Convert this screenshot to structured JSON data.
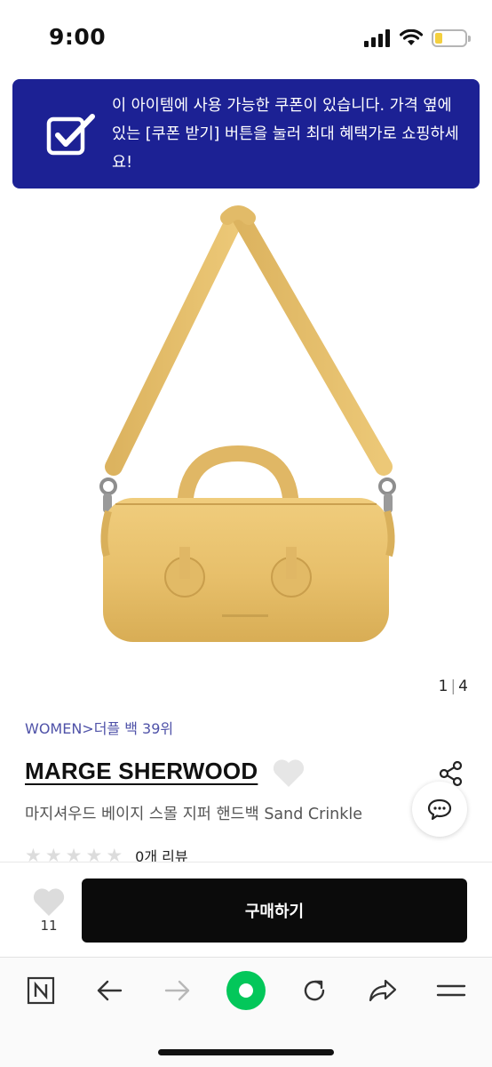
{
  "status_bar": {
    "time": "9:00"
  },
  "coupon_banner": {
    "text": "이 아이템에 사용 가능한 쿠폰이 있습니다. 가격 옆에 있는 [쿠폰 받기] 버튼을 눌러 최대 혜택가로 쇼핑하세요!"
  },
  "product": {
    "pager": {
      "current": "1",
      "separator": "|",
      "total": "4"
    },
    "breadcrumb": {
      "category": "WOMEN",
      "arrow": ">",
      "subcategory": "더플 백",
      "rank": "39위"
    },
    "brand": "MARGE SHERWOOD",
    "name": "마지셔우드 베이지 스몰 지퍼 핸드백 Sand Crinkle",
    "rating": {
      "stars": 0,
      "max": 5,
      "review_text": "0개 리뷰"
    }
  },
  "purchase_bar": {
    "wish_count": "11",
    "buy_label": "구매하기"
  },
  "colors": {
    "banner": "#1c2194",
    "buy_button": "#0b0b0b",
    "breadcrumb": "#4f52a8",
    "browser_home": "#03c75a",
    "bag": "#e7bf6a"
  },
  "browser_toolbar": [
    "naver-n-icon",
    "back-arrow-icon",
    "forward-arrow-icon",
    "home-green-icon",
    "refresh-icon",
    "share-arrow-icon",
    "menu-icon"
  ]
}
